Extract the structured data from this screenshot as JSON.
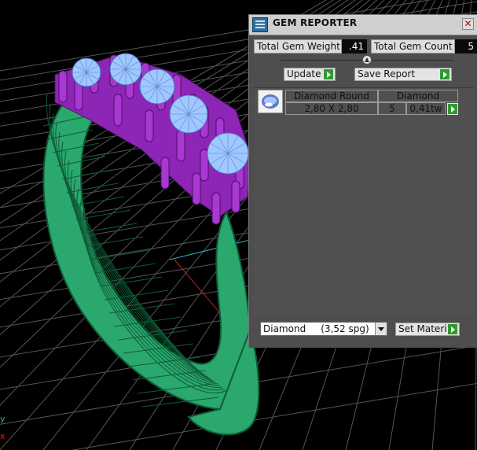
{
  "panel": {
    "title": "GEM REPORTER",
    "close_glyph": "✕",
    "total_gem_weight_label": "Total Gem Weight",
    "total_gem_weight_value": ".41",
    "total_gem_count_label": "Total Gem Count",
    "total_gem_count_value": "5",
    "update_label": "Update",
    "save_report_label": "Save Report",
    "gem_table": {
      "headers": [
        "Diamond Round",
        "Diamond"
      ],
      "rows": [
        {
          "size": "2,80 X 2,80",
          "count": "5",
          "weight": "0,41tw"
        }
      ]
    },
    "material_select_value": "Diamond     (3,52 spg)",
    "set_material_label": "Set Material"
  },
  "viewport": {
    "axis_labels": [
      "y",
      "x"
    ],
    "colors": {
      "background": "#000000",
      "grid": "#5a5a5a",
      "band": "#2aa86d",
      "prongs": "#9a2cc4",
      "gems": "#9fc8ff"
    }
  },
  "icons": [
    "gem-reporter-app-icon",
    "close-icon",
    "play-icon",
    "dropdown-arrow-icon",
    "diamond-thumbnail-icon"
  ]
}
